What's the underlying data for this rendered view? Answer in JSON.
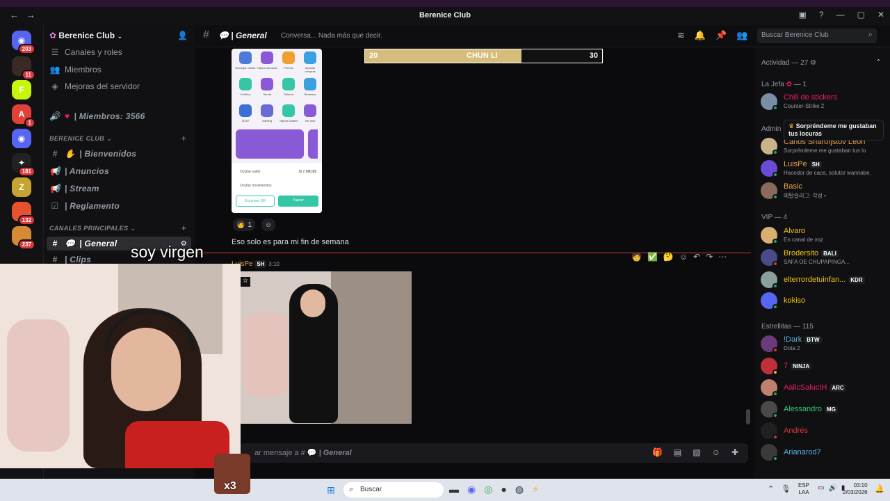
{
  "window": {
    "title": "Berenice Club",
    "nav_back": "←",
    "nav_forward": "→",
    "controls": [
      "—",
      "▢",
      "✕"
    ]
  },
  "servers": [
    {
      "name": "discord-home",
      "badge": "203",
      "color": "#5865f2",
      "glyph": "◉"
    },
    {
      "name": "server-2",
      "badge": "11",
      "color": "#3a2a25",
      "glyph": ""
    },
    {
      "name": "server-3",
      "badge": "",
      "color": "#c6f60a",
      "glyph": "F"
    },
    {
      "name": "server-4",
      "badge": "1",
      "color": "#e0423a",
      "glyph": "A"
    },
    {
      "name": "server-5",
      "badge": "",
      "color": "#5865f2",
      "glyph": "◉"
    },
    {
      "name": "server-6",
      "badge": "181",
      "color": "#222",
      "glyph": "✦"
    },
    {
      "name": "server-7",
      "badge": "",
      "color": "#c7a431",
      "glyph": "Z"
    },
    {
      "name": "server-8",
      "badge": "132",
      "color": "#e6522e",
      "glyph": ""
    },
    {
      "name": "server-9",
      "badge": "237",
      "color": "#d68a33",
      "glyph": ""
    }
  ],
  "sidebar": {
    "server_name": "Berenice Club",
    "items": [
      {
        "label": "Canales y roles",
        "icon": "☰"
      },
      {
        "label": "Miembros",
        "icon": "👥"
      },
      {
        "label": "Mejoras del servidor",
        "icon": "◈"
      }
    ],
    "member_count_label": "| Miembros: 3566",
    "category1": "BERENICE CLUB",
    "channels1": [
      {
        "label": "| Bienvenidos",
        "icon": "#"
      },
      {
        "label": "| Anuncios",
        "icon": "📢"
      },
      {
        "label": "| Stream",
        "icon": "📢"
      },
      {
        "label": "| Reglamento",
        "icon": "☑"
      }
    ],
    "category2": "CANALES PRINCIPALES",
    "active_channel": "| General",
    "next_channel": "| Clips"
  },
  "header": {
    "channel_name": "| General",
    "topic": "Conversa... Nada más que decir.",
    "search_placeholder": "Buscar Berenice Club"
  },
  "stream_overlay": {
    "left_value": "20",
    "center_label": "CHUN LI",
    "right_value": "30",
    "fill_fraction": 0.66
  },
  "phone_screenshot": {
    "apps": [
      "Recargar celular",
      "Yapear servicios",
      "Promos",
      "Aprobar compras",
      "Créditos",
      "Tienda",
      "Dólares",
      "Remesas",
      "SOAT",
      "Gaming",
      "Yapear dólares",
      "Ver todo"
    ],
    "hide_balance": "Ocultar saldo",
    "balance": "S/ 7,990.89",
    "hide_movements": "Ocultar movimientos",
    "scan_button": "Escanear QR",
    "yapear_button": "Yapear"
  },
  "chat": {
    "reaction_count": "1",
    "message_text": "Eso solo es para mi fin de semana",
    "author": "LuisPe",
    "author_tag": "SH",
    "timestamp": "3:10",
    "caption": "soy virgen",
    "composer_placeholder_prefix": "ar mensaje a #",
    "composer_channel": "| General",
    "emote_label": "x3"
  },
  "members": {
    "activity_header": "Actividad — 27",
    "tooltip": "Sorpréndeme me gustaban tus locuras",
    "groups": [
      {
        "label": "La Jefa",
        "count": "— 1"
      },
      {
        "label": "Admin",
        "count": ""
      },
      {
        "label": "VIP",
        "count": "— 4"
      },
      {
        "label": "Estrellitas",
        "count": "— 115"
      }
    ],
    "list": [
      {
        "name": "Chill de stickers",
        "status": "Counter-Strike 2",
        "color": "#e91e63",
        "tag": "",
        "dot": "#23a55a"
      },
      {
        "name": "Carlos Sharofjstov Leon",
        "status": "Sorpréndeme me gustaban tus lo",
        "color": "#e8a54b",
        "tag": "",
        "dot": "#23a55a"
      },
      {
        "name": "LuisPe",
        "status": "Hacedor de caos, solutor wannabe.",
        "color": "#e8a54b",
        "tag": "SH",
        "dot": "#23a55a"
      },
      {
        "name": "Basic",
        "status": "메탈슬러그: 각성 •",
        "color": "#e8a54b",
        "tag": "",
        "dot": "#23a55a"
      },
      {
        "name": "Alvaro",
        "status": "En canal de voz",
        "color": "#f1c40f",
        "tag": "",
        "dot": "#23a55a"
      },
      {
        "name": "Brodersito",
        "status": "SAFA OE CHUPAPINGA...",
        "color": "#f1c40f",
        "tag": "BALI",
        "dot": "#da373c"
      },
      {
        "name": "elterrordetuinfan...",
        "status": "",
        "color": "#f1c40f",
        "tag": "KDR",
        "dot": "#23a55a"
      },
      {
        "name": "kokiso",
        "status": "",
        "color": "#f1c40f",
        "tag": "",
        "dot": "#23a55a"
      },
      {
        "name": "!Dark",
        "status": "Dota 2",
        "color": "#5dade2",
        "tag": "BTW",
        "dot": "#da373c"
      },
      {
        "name": "7",
        "status": "",
        "color": "#e91e63",
        "tag": "NINJA",
        "dot": "#f0b232"
      },
      {
        "name": "AalicSaluctH",
        "status": "",
        "color": "#e91e63",
        "tag": "ARC",
        "dot": "#23a55a"
      },
      {
        "name": "Alessandro",
        "status": "",
        "color": "#2ecc71",
        "tag": "MG",
        "dot": "#23a55a"
      },
      {
        "name": "Andrés",
        "status": "",
        "color": "#da373c",
        "tag": "",
        "dot": "#da373c"
      },
      {
        "name": "Arianarod7",
        "status": "",
        "color": "#5dade2",
        "tag": "",
        "dot": "#23a55a"
      }
    ]
  },
  "taskbar": {
    "search_placeholder": "Buscar",
    "lang_top": "ESP",
    "lang_bottom": "LAA",
    "time": "03:10",
    "date": "2/03/2026"
  }
}
